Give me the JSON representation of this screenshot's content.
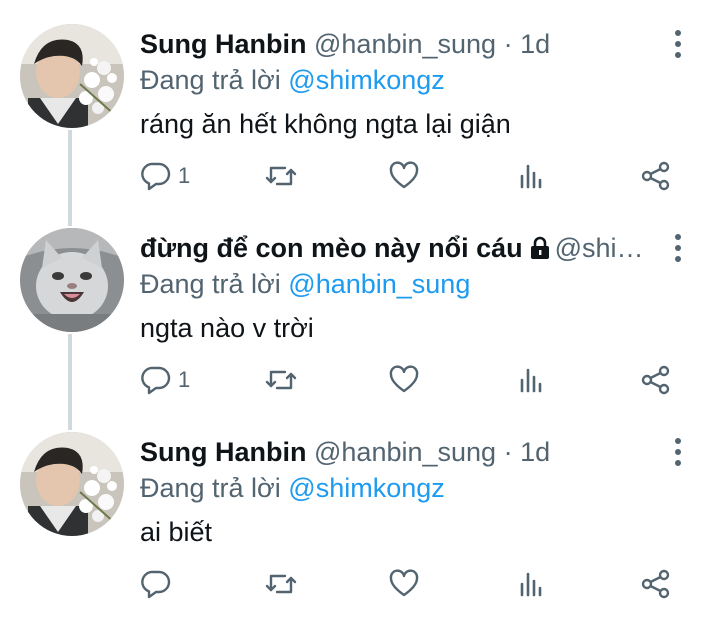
{
  "thread": {
    "tweets": [
      {
        "author_name": "Sung Hanbin",
        "author_handle": "@hanbin_sung",
        "separator": "·",
        "time": "1d",
        "replying_label": "Đang trả lời",
        "replying_to": "@shimkongz",
        "text": "ráng ăn hết không ngta lại giận",
        "reply_count": "1",
        "avatar": "user-photo-flowers",
        "locked": false
      },
      {
        "author_name": "đừng để con mèo này nổi cáu",
        "author_handle": "@shi…",
        "separator": "",
        "time": "",
        "replying_label": "Đang trả lời",
        "replying_to": "@hanbin_sung",
        "text": "ngta nào v trời",
        "reply_count": "1",
        "avatar": "cat-photo",
        "locked": true
      },
      {
        "author_name": "Sung Hanbin",
        "author_handle": "@hanbin_sung",
        "separator": "·",
        "time": "1d",
        "replying_label": "Đang trả lời",
        "replying_to": "@shimkongz",
        "text": "ai biết",
        "reply_count": "",
        "avatar": "user-photo-flowers",
        "locked": false
      }
    ]
  },
  "icons": {
    "reply": "reply-icon",
    "retweet": "retweet-icon",
    "like": "like-icon",
    "analytics": "analytics-icon",
    "share": "share-icon",
    "more": "more-vertical-icon",
    "lock": "lock-icon"
  },
  "colors": {
    "text": "#0f1419",
    "secondary": "#536471",
    "link": "#1d9bf0",
    "thread_line": "#cfd9de"
  }
}
